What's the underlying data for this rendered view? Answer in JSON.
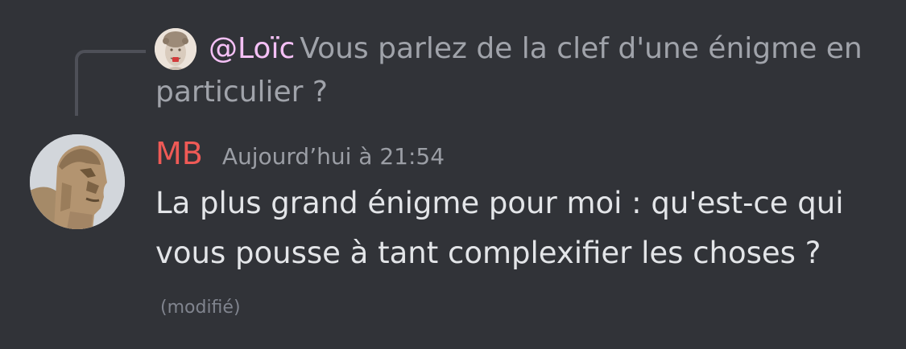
{
  "reply": {
    "author": "@Loïc",
    "text": "Vous parlez de la clef d'une énigme en particulier ?",
    "avatar_icon": "david-statue-avatar"
  },
  "message": {
    "author": "MB",
    "author_color": "#ef5a56",
    "timestamp": "Aujourd’hui à 21:54",
    "text": "La plus grand énigme pour moi : qu'est-ce qui vous pousse à tant complexifier les choses ?",
    "edited_label": "(modifié)",
    "avatar_icon": "sphinx-avatar"
  },
  "colors": {
    "background": "#313338",
    "reply_author": "#f4c0f5",
    "text": "#e3e5e8",
    "muted": "#a0a3aa"
  }
}
